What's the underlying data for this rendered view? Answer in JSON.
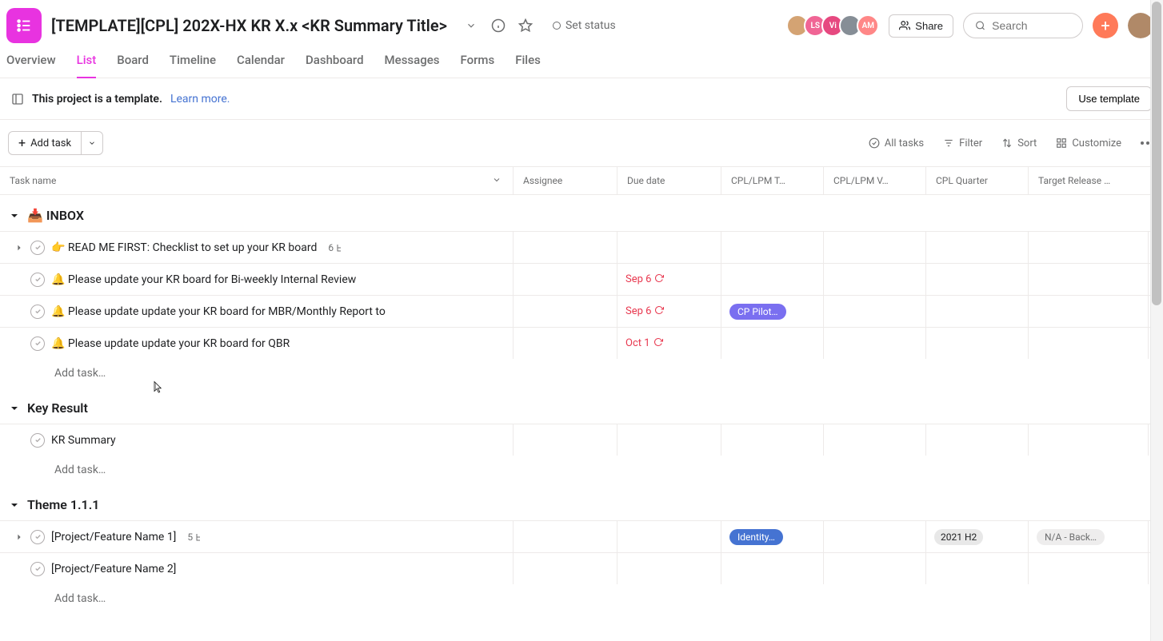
{
  "header": {
    "title": "[TEMPLATE][CPL] 202X-HX KR X.x <KR Summary Title>",
    "set_status_label": "Set status",
    "share_label": "Share",
    "search_placeholder": "Search"
  },
  "avatars": [
    {
      "label": "",
      "bg": "#d4a373"
    },
    {
      "label": "LS",
      "bg": "#f06595"
    },
    {
      "label": "Vi",
      "bg": "#e64980"
    },
    {
      "label": "",
      "bg": "#868e96"
    },
    {
      "label": "AM",
      "bg": "#ff8787"
    }
  ],
  "tabs": [
    "Overview",
    "List",
    "Board",
    "Timeline",
    "Calendar",
    "Dashboard",
    "Messages",
    "Forms",
    "Files"
  ],
  "active_tab": "List",
  "banner": {
    "template_text": "This project is a template.",
    "learn_more": "Learn more.",
    "use_template": "Use template"
  },
  "toolbar": {
    "add_task": "Add task",
    "all_tasks": "All tasks",
    "filter": "Filter",
    "sort": "Sort",
    "customize": "Customize"
  },
  "columns": {
    "name": "Task name",
    "assignee": "Assignee",
    "due": "Due date",
    "cplt": "CPL/LPM T…",
    "cplv": "CPL/LPM V…",
    "quarter": "CPL Quarter",
    "target": "Target Release …"
  },
  "sections": [
    {
      "title": "📥 INBOX",
      "tasks": [
        {
          "name": "👉 READ ME FIRST: Checklist to set up your KR board",
          "expandable": true,
          "subtask_count": "6",
          "indent": 0
        },
        {
          "name": "🔔 Please update your KR board for Bi-weekly Internal Review",
          "due": "Sep 6",
          "recurring": true,
          "indent": 1
        },
        {
          "name": "🔔 Please update update your KR board for MBR/Monthly Report to",
          "due": "Sep 6",
          "recurring": true,
          "tag": {
            "text": "CP Pilot…",
            "class": "tag-purple"
          },
          "indent": 1
        },
        {
          "name": "🔔 Please update update your KR board for QBR",
          "due": "Oct 1",
          "recurring": true,
          "indent": 1
        }
      ],
      "add_task": "Add task…"
    },
    {
      "title": "Key Result",
      "tasks": [
        {
          "name": "KR Summary",
          "indent": 1
        }
      ],
      "add_task": "Add task…"
    },
    {
      "title": "Theme 1.1.1",
      "tasks": [
        {
          "name": "[Project/Feature Name 1]",
          "expandable": true,
          "subtask_count": "5",
          "tag": {
            "text": "Identity…",
            "class": "tag-blue"
          },
          "quarter": {
            "text": "2021 H2",
            "class": "tag-gray"
          },
          "target": {
            "text": "N/A - Back…",
            "class": "tag-lightgray"
          },
          "indent": 0
        },
        {
          "name": "[Project/Feature Name 2]",
          "indent": 1
        }
      ],
      "add_task": "Add task…"
    }
  ]
}
